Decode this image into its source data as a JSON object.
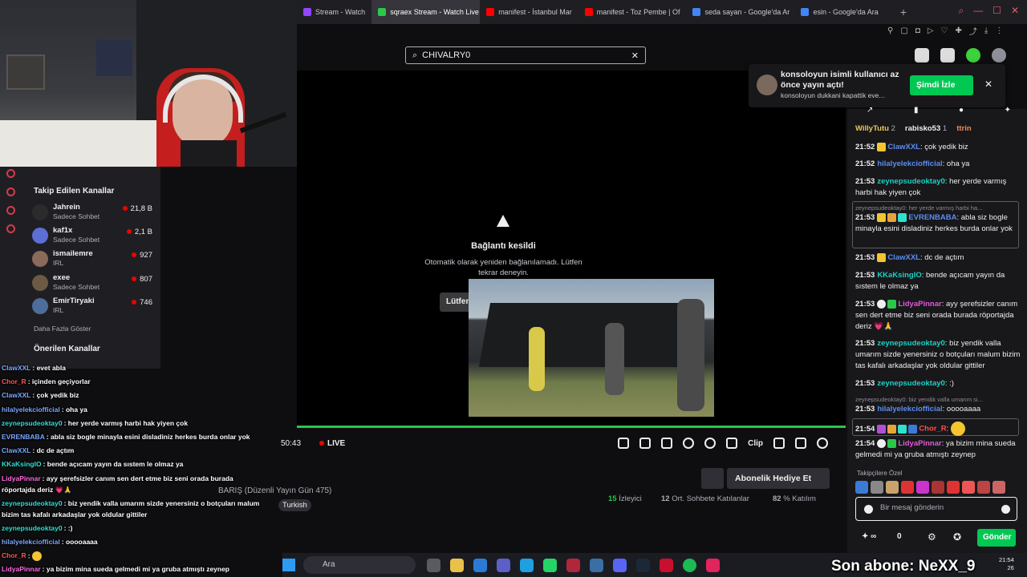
{
  "browser": {
    "tabs": [
      {
        "label": "Stream - Watch",
        "color": "#9146ff",
        "active": false
      },
      {
        "label": "sqraex Stream - Watch Live",
        "color": "#29c74a",
        "active": true
      },
      {
        "label": "manifest - İstanbul Mar",
        "color": "#ff0000",
        "active": false
      },
      {
        "label": "manifest - Toz Pembe | Of",
        "color": "#ff0000",
        "active": false
      },
      {
        "label": "seda sayan - Google'da Ar",
        "color": "#4285f4",
        "active": false
      },
      {
        "label": "esin - Google'da Ara",
        "color": "#4285f4",
        "active": false
      }
    ],
    "new_tab": "+"
  },
  "sidebar": {
    "followed_title": "Takip Edilen Kanallar",
    "channels": [
      {
        "name": "Jahrein",
        "sub": "Sadece Sohbet",
        "viewers": "21,8 B"
      },
      {
        "name": "kaf1x",
        "sub": "Sadece Sohbet",
        "viewers": "2,1 B"
      },
      {
        "name": "ismailemre",
        "sub": "IRL",
        "viewers": "927"
      },
      {
        "name": "exee",
        "sub": "Sadece Sohbet",
        "viewers": "807"
      },
      {
        "name": "EmirTiryaki",
        "sub": "IRL",
        "viewers": "746"
      }
    ],
    "show_more": "Daha Fazla Göster",
    "recommended_title": "Önerilen Kanallar"
  },
  "search": {
    "value": "CHIVALRY0"
  },
  "player": {
    "error_title": "Bağlantı kesildi",
    "error_message": "Otomatik olarak yeniden bağlanılamadı. Lütfen tekrar deneyin.",
    "retry_label": "Lütfen",
    "time": "50:43",
    "live": "LIVE",
    "clip_label": "Clip"
  },
  "stream": {
    "title": "BARIŞ (Düzenli Yayın Gün 475)",
    "tag": "Turkish",
    "gift_label": "Abonelik Hediye Et",
    "viewers": "15",
    "viewers_label": "İzleyici",
    "chatters": "12",
    "chatters_label": "Ort. Sohbete Katılanlar",
    "percent": "82",
    "percent_label": "% Katılım"
  },
  "notification": {
    "title": "konsoloyun isimli kullanıcı az önce yayın açtı!",
    "subtitle": "konsoloyun dukkani kapattik eve...",
    "watch_label": "Şimdi İzle"
  },
  "chat": {
    "top": [
      {
        "name": "WillyTutu",
        "n": "2"
      },
      {
        "name": "rabisko53",
        "n": "1"
      },
      {
        "name": "ttrin",
        "n": ""
      }
    ],
    "messages": [
      {
        "ts": "21:52",
        "user": "ClawXXL",
        "color": "#5b8def",
        "text": ": çok yedik biz"
      },
      {
        "ts": "21:52",
        "user": "hilalyelekciofficial",
        "color": "#5b8def",
        "text": ": oha ya"
      },
      {
        "ts": "21:53",
        "user": "zeynepsudeoktay0",
        "color": "#19d3c5",
        "text": ": her yerde varmış harbi hak yiyen çok"
      },
      {
        "ts": "21:53",
        "user": "EVRENBABA",
        "color": "#5b8def",
        "text": ": abla siz bogle minayla esini disladiniz herkes burda onlar yok"
      },
      {
        "ts": "21:53",
        "user": "ClawXXL",
        "color": "#5b8def",
        "text": ": dc de açtım"
      },
      {
        "ts": "21:53",
        "user": "KKaKsingIO",
        "color": "#19d3c5",
        "text": ": bende açıcam yayın da sıstem le olmaz ya"
      },
      {
        "ts": "21:53",
        "user": "LidyaPinnar",
        "color": "#e05ad6",
        "text": ": ayy şerefsizler canım sen dert etme biz seni orada burada röportajda deriz 💗🙏"
      },
      {
        "ts": "21:53",
        "user": "zeynepsudeoktay0",
        "color": "#19d3c5",
        "text": ": biz yendik valla umarım sizde yenersiniz o botçuları malum bizim tas kafalı arkadaşlar yok oldular gittiler"
      },
      {
        "ts": "21:53",
        "user": "zeynepsudeoktay0",
        "color": "#19d3c5",
        "text": ": :)"
      },
      {
        "ts": "21:53",
        "user": "hilalyelekciofficial",
        "color": "#5b8def",
        "text": ": ooooaaaa"
      },
      {
        "ts": "21:54",
        "user": "Chor_R",
        "color": "#ff4d4d",
        "text": ":"
      },
      {
        "ts": "21:54",
        "user": "LidyaPinnar",
        "color": "#e05ad6",
        "text": ": ya bizim mina sueda gelmedi mi ya gruba atmıştı zeynep"
      }
    ],
    "reply1": "zeynepsudeoktay0: her yerde varmış harbi ha...",
    "reply2": "zeynepsudeoktay0: biz yendik valla umarım si...",
    "followers_only": "Takipçilere Özel",
    "input_placeholder": "Bir mesaj gönderin",
    "points": "0",
    "send_label": "Gönder"
  },
  "overlay_chat": [
    {
      "user": "ClawXXL",
      "color": "#7aa7ff",
      "text": ": evet abla"
    },
    {
      "user": "Chor_R",
      "color": "#ff5555",
      "text": ": içinden geçiyorlar"
    },
    {
      "user": "ClawXXL",
      "color": "#7aa7ff",
      "text": ": çok yedik biz"
    },
    {
      "user": "hilalyelekciofficial",
      "color": "#7aa7ff",
      "text": ": oha ya"
    },
    {
      "user": "zeynepsudeoktay0",
      "color": "#2fe0d0",
      "text": ": her yerde varmış harbi hak yiyen çok"
    },
    {
      "user": "EVRENBABA",
      "color": "#7aa7ff",
      "text": ": abla siz bogle minayla esini disladiniz herkes burda onlar yok"
    },
    {
      "user": "ClawXXL",
      "color": "#7aa7ff",
      "text": ": dc de açtım"
    },
    {
      "user": "KKaKsingIO",
      "color": "#2fe0d0",
      "text": ": bende açıcam yayın da sıstem le olmaz ya"
    },
    {
      "user": "LidyaPinnar",
      "color": "#ff6adf",
      "text": ": ayy şerefsizler canım sen dert etme biz seni orada burada"
    },
    {
      "user": "",
      "color": "#ffffff",
      "text": "röportajda deriz 💗🙏"
    },
    {
      "user": "zeynepsudeoktay0",
      "color": "#2fe0d0",
      "text": ": biz yendik valla umarım sizde yenersiniz o botçuları malum"
    },
    {
      "user": "",
      "color": "#ffffff",
      "text": "bizim tas kafalı arkadaşlar yok oldular gittiler"
    },
    {
      "user": "zeynepsudeoktay0",
      "color": "#2fe0d0",
      "text": ": :)"
    },
    {
      "user": "hilalyelekciofficial",
      "color": "#7aa7ff",
      "text": ": ooooaaaa"
    },
    {
      "user": "Chor_R",
      "color": "#ff5555",
      "text": ":"
    },
    {
      "user": "LidyaPinnar",
      "color": "#ff6adf",
      "text": ": ya bizim mina sueda gelmedi mi ya gruba atmıştı zeynep"
    }
  ],
  "taskbar": {
    "search": "Ara",
    "clock_time": "21:54",
    "clock_date": "26"
  },
  "overlay_banner": "Son abone: NeXX_9"
}
